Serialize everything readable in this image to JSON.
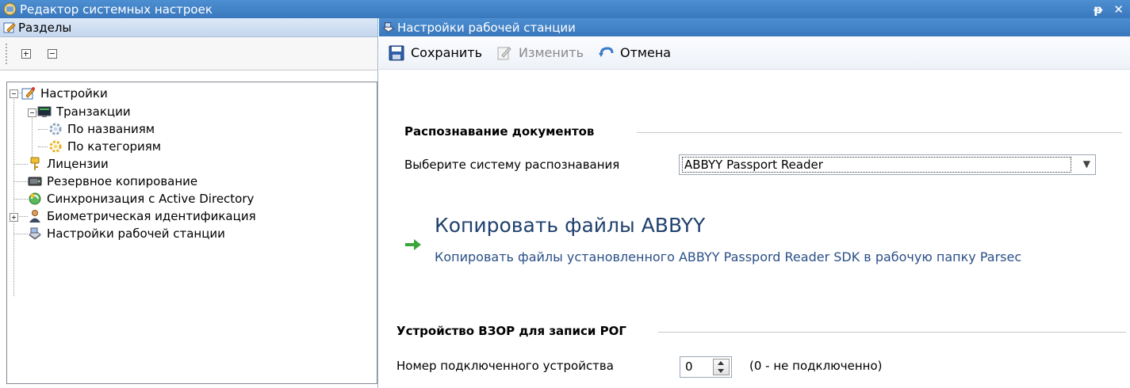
{
  "window": {
    "title": "Редактор системных настроек",
    "icon": "settings-editor-icon",
    "pin_glyph": "ᵽ",
    "close_glyph": "✕"
  },
  "left_panel": {
    "title": "Разделы",
    "icon": "edit-icon",
    "toolbar": {
      "expand_all": "expand-all",
      "collapse_all": "collapse-all"
    },
    "tree": [
      {
        "label": "Настройки",
        "icon": "settings-edit-icon",
        "level": 0,
        "expander": "minus"
      },
      {
        "label": "Транзакции",
        "icon": "monitor-icon",
        "level": 1,
        "expander": "minus"
      },
      {
        "label": "По названиям",
        "icon": "gear-icon",
        "level": 2,
        "expander": ""
      },
      {
        "label": "По категориям",
        "icon": "gear-yellow-icon",
        "level": 2,
        "expander": ""
      },
      {
        "label": "Лицензии",
        "icon": "key-icon",
        "level": 1,
        "expander": ""
      },
      {
        "label": "Резервное копирование",
        "icon": "disk-icon",
        "level": 1,
        "expander": ""
      },
      {
        "label": "Синхронизация с Active Directory",
        "icon": "sync-icon",
        "level": 1,
        "expander": ""
      },
      {
        "label": "Биометрическая идентификация",
        "icon": "person-icon",
        "level": 1,
        "expander": "plus"
      },
      {
        "label": "Настройки рабочей станции",
        "icon": "workstation-icon",
        "level": 1,
        "expander": "",
        "selected": true
      }
    ]
  },
  "right_panel": {
    "title": "Настройки рабочей станции",
    "icon": "workstation-icon",
    "toolbar": {
      "save_label": "Сохранить",
      "edit_label": "Изменить",
      "cancel_label": "Отмена"
    },
    "recognition": {
      "group_title": "Распознавание документов",
      "select_label": "Выберите систему распознавания",
      "selected_value": "ABBYY Passport Reader"
    },
    "copy_action": {
      "title": "Копировать файлы ABBYY",
      "description": "Копировать файлы установленного ABBYY Passpord Reader SDK в рабочую папку Parsec"
    },
    "device": {
      "group_title": "Устройство ВЗОР для записи РОГ",
      "number_label": "Номер подключенного устройства",
      "number_value": "0",
      "hint": "(0 - не подключенно)"
    }
  },
  "colors": {
    "title_bar": "#3f80c6",
    "panel_header": "#d0dff2",
    "link": "#2a4f86",
    "arrow_green": "#3aa53a"
  }
}
